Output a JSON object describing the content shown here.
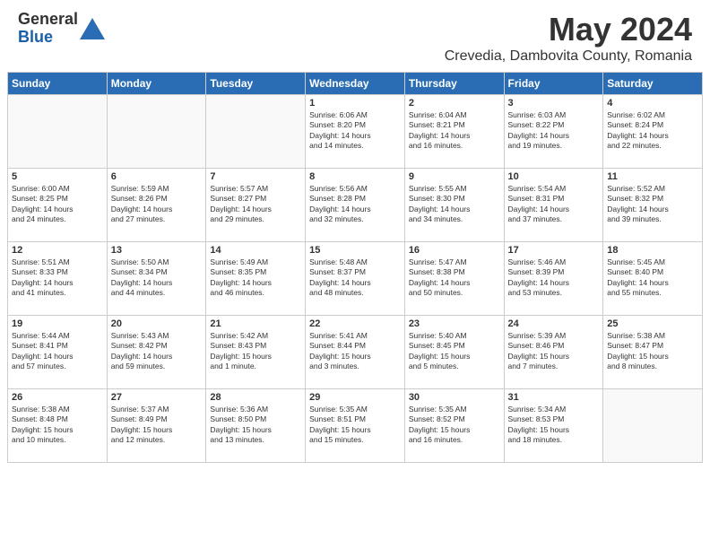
{
  "logo": {
    "general": "General",
    "blue": "Blue"
  },
  "title": {
    "month_year": "May 2024",
    "location": "Crevedia, Dambovita County, Romania"
  },
  "headers": [
    "Sunday",
    "Monday",
    "Tuesday",
    "Wednesday",
    "Thursday",
    "Friday",
    "Saturday"
  ],
  "weeks": [
    [
      {
        "day": "",
        "info": ""
      },
      {
        "day": "",
        "info": ""
      },
      {
        "day": "",
        "info": ""
      },
      {
        "day": "1",
        "info": "Sunrise: 6:06 AM\nSunset: 8:20 PM\nDaylight: 14 hours\nand 14 minutes."
      },
      {
        "day": "2",
        "info": "Sunrise: 6:04 AM\nSunset: 8:21 PM\nDaylight: 14 hours\nand 16 minutes."
      },
      {
        "day": "3",
        "info": "Sunrise: 6:03 AM\nSunset: 8:22 PM\nDaylight: 14 hours\nand 19 minutes."
      },
      {
        "day": "4",
        "info": "Sunrise: 6:02 AM\nSunset: 8:24 PM\nDaylight: 14 hours\nand 22 minutes."
      }
    ],
    [
      {
        "day": "5",
        "info": "Sunrise: 6:00 AM\nSunset: 8:25 PM\nDaylight: 14 hours\nand 24 minutes."
      },
      {
        "day": "6",
        "info": "Sunrise: 5:59 AM\nSunset: 8:26 PM\nDaylight: 14 hours\nand 27 minutes."
      },
      {
        "day": "7",
        "info": "Sunrise: 5:57 AM\nSunset: 8:27 PM\nDaylight: 14 hours\nand 29 minutes."
      },
      {
        "day": "8",
        "info": "Sunrise: 5:56 AM\nSunset: 8:28 PM\nDaylight: 14 hours\nand 32 minutes."
      },
      {
        "day": "9",
        "info": "Sunrise: 5:55 AM\nSunset: 8:30 PM\nDaylight: 14 hours\nand 34 minutes."
      },
      {
        "day": "10",
        "info": "Sunrise: 5:54 AM\nSunset: 8:31 PM\nDaylight: 14 hours\nand 37 minutes."
      },
      {
        "day": "11",
        "info": "Sunrise: 5:52 AM\nSunset: 8:32 PM\nDaylight: 14 hours\nand 39 minutes."
      }
    ],
    [
      {
        "day": "12",
        "info": "Sunrise: 5:51 AM\nSunset: 8:33 PM\nDaylight: 14 hours\nand 41 minutes."
      },
      {
        "day": "13",
        "info": "Sunrise: 5:50 AM\nSunset: 8:34 PM\nDaylight: 14 hours\nand 44 minutes."
      },
      {
        "day": "14",
        "info": "Sunrise: 5:49 AM\nSunset: 8:35 PM\nDaylight: 14 hours\nand 46 minutes."
      },
      {
        "day": "15",
        "info": "Sunrise: 5:48 AM\nSunset: 8:37 PM\nDaylight: 14 hours\nand 48 minutes."
      },
      {
        "day": "16",
        "info": "Sunrise: 5:47 AM\nSunset: 8:38 PM\nDaylight: 14 hours\nand 50 minutes."
      },
      {
        "day": "17",
        "info": "Sunrise: 5:46 AM\nSunset: 8:39 PM\nDaylight: 14 hours\nand 53 minutes."
      },
      {
        "day": "18",
        "info": "Sunrise: 5:45 AM\nSunset: 8:40 PM\nDaylight: 14 hours\nand 55 minutes."
      }
    ],
    [
      {
        "day": "19",
        "info": "Sunrise: 5:44 AM\nSunset: 8:41 PM\nDaylight: 14 hours\nand 57 minutes."
      },
      {
        "day": "20",
        "info": "Sunrise: 5:43 AM\nSunset: 8:42 PM\nDaylight: 14 hours\nand 59 minutes."
      },
      {
        "day": "21",
        "info": "Sunrise: 5:42 AM\nSunset: 8:43 PM\nDaylight: 15 hours\nand 1 minute."
      },
      {
        "day": "22",
        "info": "Sunrise: 5:41 AM\nSunset: 8:44 PM\nDaylight: 15 hours\nand 3 minutes."
      },
      {
        "day": "23",
        "info": "Sunrise: 5:40 AM\nSunset: 8:45 PM\nDaylight: 15 hours\nand 5 minutes."
      },
      {
        "day": "24",
        "info": "Sunrise: 5:39 AM\nSunset: 8:46 PM\nDaylight: 15 hours\nand 7 minutes."
      },
      {
        "day": "25",
        "info": "Sunrise: 5:38 AM\nSunset: 8:47 PM\nDaylight: 15 hours\nand 8 minutes."
      }
    ],
    [
      {
        "day": "26",
        "info": "Sunrise: 5:38 AM\nSunset: 8:48 PM\nDaylight: 15 hours\nand 10 minutes."
      },
      {
        "day": "27",
        "info": "Sunrise: 5:37 AM\nSunset: 8:49 PM\nDaylight: 15 hours\nand 12 minutes."
      },
      {
        "day": "28",
        "info": "Sunrise: 5:36 AM\nSunset: 8:50 PM\nDaylight: 15 hours\nand 13 minutes."
      },
      {
        "day": "29",
        "info": "Sunrise: 5:35 AM\nSunset: 8:51 PM\nDaylight: 15 hours\nand 15 minutes."
      },
      {
        "day": "30",
        "info": "Sunrise: 5:35 AM\nSunset: 8:52 PM\nDaylight: 15 hours\nand 16 minutes."
      },
      {
        "day": "31",
        "info": "Sunrise: 5:34 AM\nSunset: 8:53 PM\nDaylight: 15 hours\nand 18 minutes."
      },
      {
        "day": "",
        "info": ""
      }
    ]
  ]
}
